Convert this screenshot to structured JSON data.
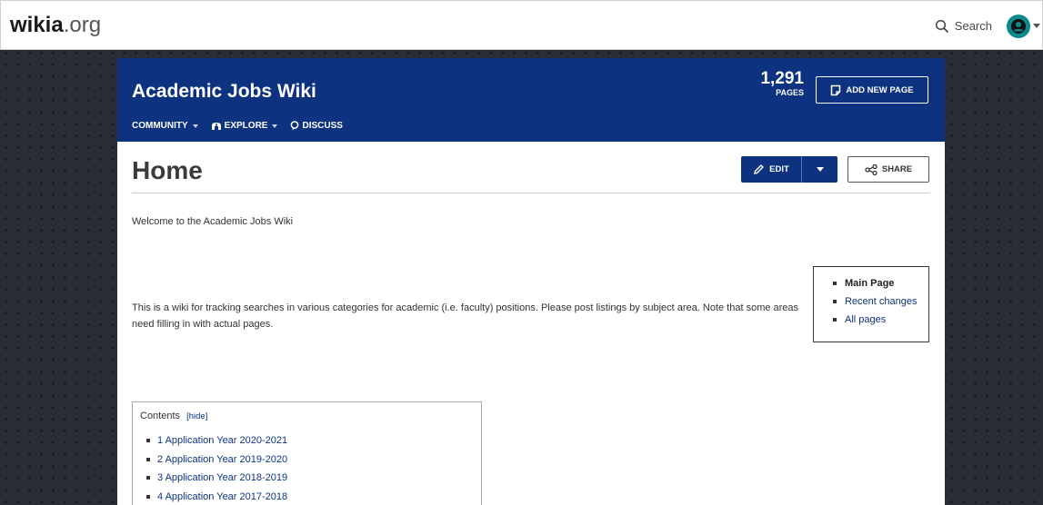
{
  "global_nav": {
    "logo_brand": "wikia",
    "logo_tld": ".org",
    "search_label": "Search"
  },
  "wiki": {
    "title": "Academic Jobs Wiki",
    "nav": [
      "COMMUNITY",
      "EXPLORE",
      "DISCUSS"
    ],
    "page_count": "1,291",
    "page_count_label": "PAGES",
    "add_page_label": "ADD NEW PAGE"
  },
  "page": {
    "title": "Home",
    "edit_label": "EDIT",
    "share_label": "SHARE",
    "welcome": "Welcome to the Academic Jobs Wiki",
    "intro": "This is a wiki for tracking searches in various categories for academic (i.e. faculty) positions. Please post listings by subject area. Note that some areas need filling in with actual pages."
  },
  "side_box": {
    "items": [
      "Main Page",
      "Recent changes",
      "All pages"
    ]
  },
  "toc": {
    "heading": "Contents",
    "hide_label": "[hide]",
    "items": [
      "1 Application Year 2020-2021",
      "2 Application Year 2019-2020",
      "3 Application Year 2018-2019",
      "4  Application Year 2017-2018"
    ]
  },
  "colors": {
    "brand_blue": "#0d3380",
    "link_blue": "#0d3380",
    "avatar_teal": "#0a8a8c"
  },
  "icons": [
    "search-icon",
    "user-avatar-icon",
    "add-page-icon",
    "explore-icon",
    "discuss-icon",
    "pencil-icon",
    "share-icon"
  ]
}
